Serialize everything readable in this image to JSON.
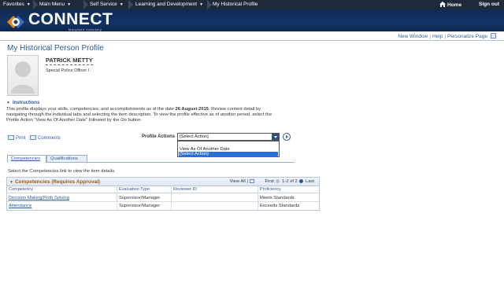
{
  "topnav": {
    "items": [
      {
        "label": "Favorites",
        "has_menu": true
      },
      {
        "label": "Main Menu",
        "has_menu": true
      },
      {
        "label": "Self Service",
        "has_menu": true
      },
      {
        "label": "Learning and Development",
        "has_menu": true
      },
      {
        "label": "My Historical Profile",
        "has_menu": false
      }
    ],
    "home_label": "Home",
    "signout_label": "Sign out"
  },
  "banner": {
    "logo_text": "CONNECT",
    "logo_sub": "Maryland Judiciary"
  },
  "header_links": {
    "new_window": "New Window",
    "help": "Help",
    "personalize": "Personalize Page"
  },
  "page": {
    "title": "My Historical Person Profile"
  },
  "person": {
    "name": "PATRICK METTY",
    "job_title": "Special Police Officer I"
  },
  "instructions": {
    "heading": "Instructions",
    "text_before": "This profile displays your skills, competencies, and accomplishments as of the date ",
    "date": "26 August 2015",
    "text_after": ". Review content detail by navigating through the individual tabs and selecting the item description. To view the profile effective as of another period, select the Profile Action \"View As Of Another Date\" followed by the Go button."
  },
  "toolbar": {
    "print_label": "Print",
    "comments_label": "Comments",
    "profile_actions_label": "Profile Actions",
    "profile_actions_value": "[Select Action]",
    "dropdown_options": [
      "",
      "View As Of Another Date",
      "[Select Action]"
    ],
    "selected_option_index": 2
  },
  "tabs": [
    {
      "label": "Competencies",
      "active": true
    },
    {
      "label": "Qualifications",
      "active": false
    }
  ],
  "hint": "Select the Competencies link to view the item details.",
  "grid": {
    "title": "Competencies (Requires Approval)",
    "view_all": "View All",
    "first": "First",
    "range": "1-2 of 2",
    "last": "Last",
    "columns": [
      "Competency",
      "Evaluation Type",
      "Reviewer ID",
      "Proficiency"
    ],
    "rows": [
      [
        "Decision Making/Prob Solving",
        "Supervisor/Manager",
        "",
        "Meets Standards"
      ],
      [
        "Attendance",
        "Supervisor/Manager",
        "",
        "Exceeds Standards"
      ]
    ]
  },
  "colors": {
    "topnav_bg": "#1e2a3a",
    "banner_bg": "#143467",
    "link": "#2c5a96",
    "grid_title": "#a05a10",
    "dropdown_selected": "#2c6fd6"
  }
}
